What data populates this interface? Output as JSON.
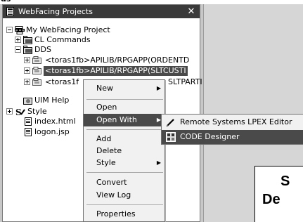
{
  "top_sliver_text": "ds",
  "panel": {
    "title": "WebFacing Projects",
    "close_label": "✕"
  },
  "tree": {
    "project": "My WebFacing Project",
    "cl_commands": "CL Commands",
    "dds": "DDS",
    "dds_item1": "<toras1fb>APILIB/RPGAPP(ORDENTD",
    "dds_item2": "<toras1fb>APILIB/RPGAPP(SLTCUSTI",
    "dds_item3_prefix": "<toras1f",
    "dds_item3_suffix": "SLTPARTI",
    "uim_help": "UIM Help",
    "style": "Style",
    "index_html": "index.html",
    "logon_jsp": "logon.jsp"
  },
  "context_menu": {
    "new": "New",
    "open": "Open",
    "open_with": "Open With",
    "add": "Add",
    "delete": "Delete",
    "style": "Style",
    "convert": "Convert",
    "view_log": "View Log",
    "properties": "Properties"
  },
  "submenu": {
    "lpex": "Remote Systems LPEX Editor",
    "code_designer": "CODE Designer"
  },
  "editor": {
    "big_line1": "S",
    "big_line2": "De"
  },
  "colors": {
    "selection": "#4a4a4a",
    "titlebar": "#3a3a3a",
    "menu_bg": "#f1f1f1"
  }
}
